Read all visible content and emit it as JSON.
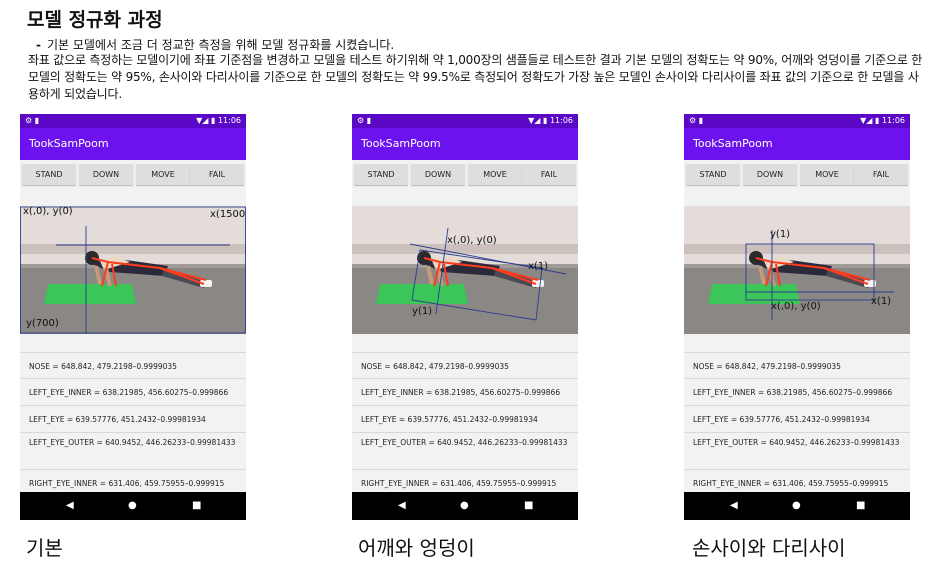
{
  "title": "모델 정규화 과정",
  "bullet": "기본 모델에서 조금 더 정교한 측정을 위해 모델 정규화를 시켰습니다.",
  "paragraph": "좌표 값으로 측정하는 모델이기에 좌표 기준점을 변경하고 모델을 테스트 하기위해 약 1,000장의 샘플들로 테스트한 결과 기본 모델의 정확도는 약 90%, 어깨와 엉덩이를 기준으로 한 모델의 정확도는 약 95%, 손사이와 다리사이를 기준으로 한 모델의 정확도는 약 99.5%로 측정되어 정확도가 가장 높은 모델인 손사이와 다리사이를 좌표 값의 기준으로 한 모델을 사용하게 되었습니다.",
  "phone": {
    "status_time": "11:06",
    "status_icons": "⚙ ▮",
    "status_right": "▼◢ ▮",
    "app_title": "TookSamPoom",
    "buttons": [
      "STAND",
      "DOWN",
      "MOVE",
      "FAIL"
    ],
    "landmarks": [
      "NOSE = 648.842, 479.2198–0.9999035",
      "LEFT_EYE_INNER = 638.21985, 456.60275–0.999866",
      "LEFT_EYE = 639.57776, 451.2432–0.99981934",
      "LEFT_EYE_OUTER = 640.9452, 446.26233–0.99981433",
      "RIGHT_EYE_INNER = 631.406, 459.75955–0.999915"
    ],
    "nav": {
      "back": "◀",
      "home": "●",
      "recent": "■"
    }
  },
  "panels": [
    {
      "caption": "기본",
      "annotations": {
        "origin": "x(,0), y(0)",
        "xmax": "x(1500)",
        "ymax": "y(700)"
      }
    },
    {
      "caption": "어깨와 엉덩이",
      "annotations": {
        "origin": "x(,0), y(0)",
        "x1": "x(1)",
        "y1": "y(1)"
      }
    },
    {
      "caption": "손사이와 다리사이",
      "annotations": {
        "origin": "x(,0), y(0)",
        "x1": "x(1)",
        "y1": "y(1)"
      }
    }
  ],
  "colors": {
    "status_bar": "#5a07c6",
    "app_bar": "#6b12ee",
    "annotation_line": "#2a3d8f",
    "skeleton": "#ff3b1f",
    "mat": "#3cc65a"
  }
}
